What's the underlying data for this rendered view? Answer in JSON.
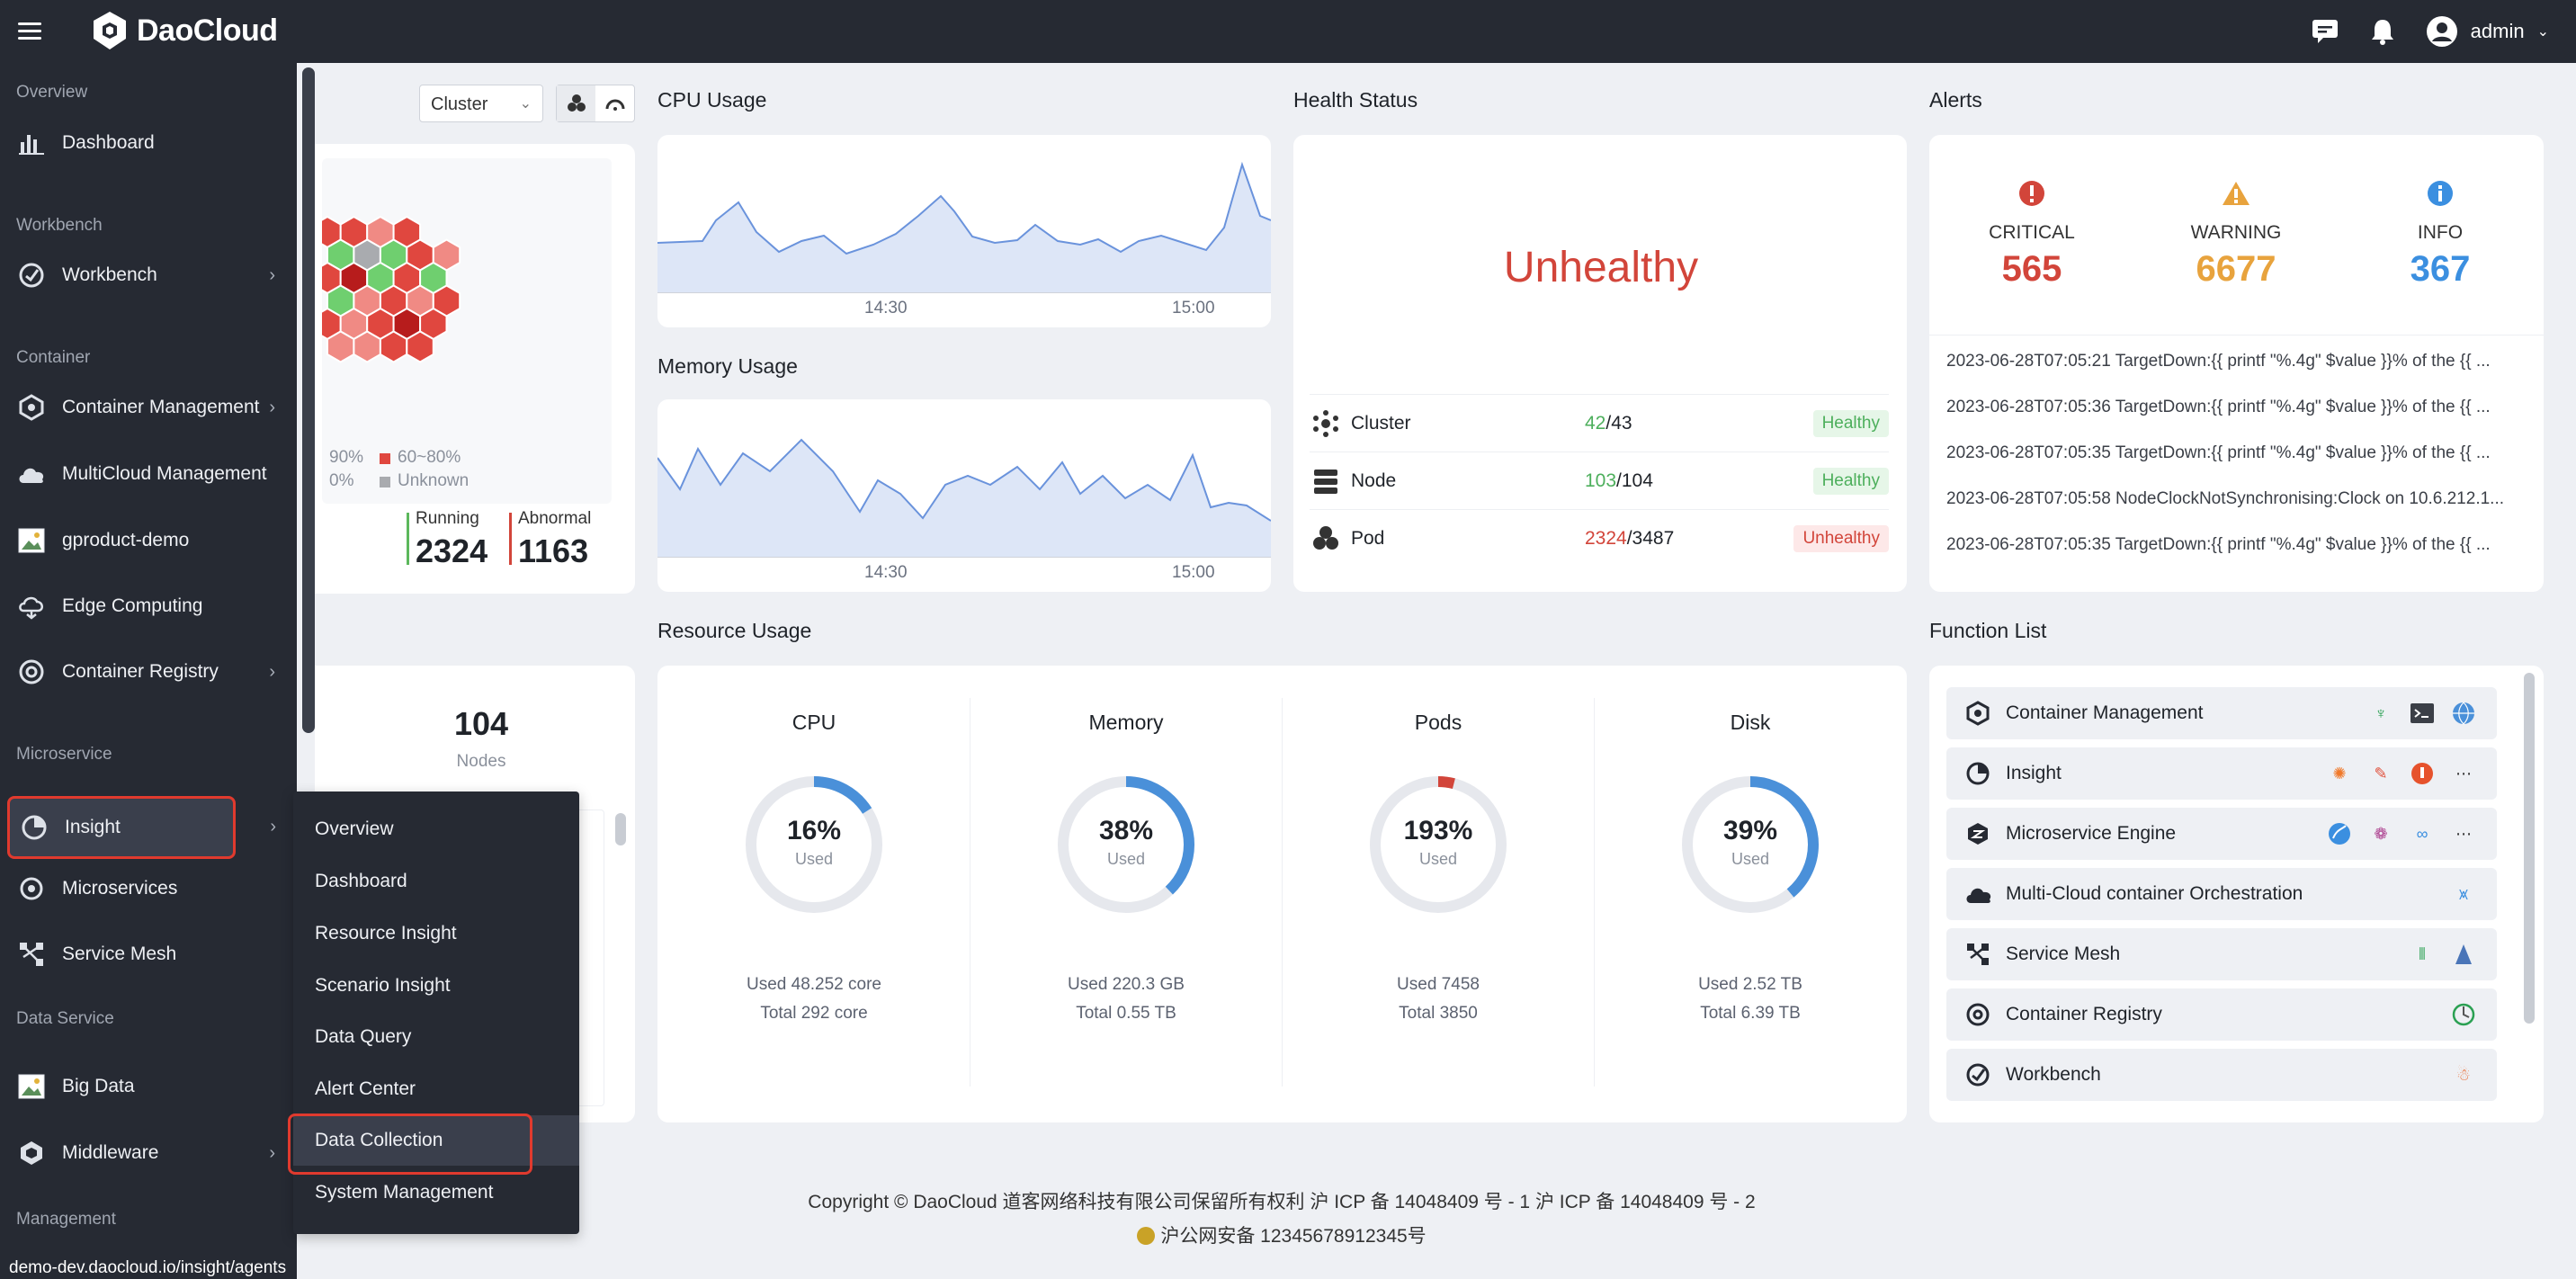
{
  "topbar": {
    "brand": "DaoCloud",
    "user": "admin"
  },
  "sidebar": {
    "groups": {
      "overview": "Overview",
      "workbench": "Workbench",
      "container": "Container",
      "microservice": "Microservice",
      "data_service": "Data Service",
      "management": "Management"
    },
    "items": {
      "dashboard": "Dashboard",
      "workbench": "Workbench",
      "container_management": "Container Management",
      "multicloud": "MultiCloud Management",
      "gproduct": "gproduct-demo",
      "edge": "Edge Computing",
      "registry": "Container Registry",
      "insight": "Insight",
      "microservices": "Microservices",
      "service_mesh": "Service Mesh",
      "big_data": "Big Data",
      "middleware": "Middleware"
    }
  },
  "submenu": {
    "items": [
      "Overview",
      "Dashboard",
      "Resource Insight",
      "Scenario Insight",
      "Data Query",
      "Alert Center",
      "Data Collection",
      "System Management"
    ]
  },
  "cluster_card": {
    "select": "Cluster",
    "legend": {
      "a": "90%",
      "b": "60~80%",
      "c": "0%",
      "d": "Unknown"
    },
    "running_label": "Running",
    "running_value": "2324",
    "abnormal_label": "Abnormal",
    "abnormal_value": "1163"
  },
  "cpu_usage": {
    "title": "CPU Usage",
    "ticks": [
      "14:30",
      "15:00"
    ]
  },
  "memory_usage": {
    "title": "Memory Usage",
    "ticks": [
      "14:30",
      "15:00"
    ]
  },
  "health": {
    "title": "Health Status",
    "status": "Unhealthy",
    "rows": [
      {
        "label": "Cluster",
        "ok": "42",
        "total": "/43",
        "badge": "Healthy"
      },
      {
        "label": "Node",
        "ok": "103",
        "total": "/104",
        "badge": "Healthy"
      },
      {
        "label": "Pod",
        "ok": "2324",
        "total": "/3487",
        "badge": "Unhealthy"
      }
    ]
  },
  "alerts": {
    "title": "Alerts",
    "critical_label": "CRITICAL",
    "critical_value": "565",
    "warning_label": "WARNING",
    "warning_value": "6677",
    "info_label": "INFO",
    "info_value": "367",
    "lines": [
      "2023-06-28T07:05:21 TargetDown:{{ printf \"%.4g\" $value }}% of the {{ ...",
      "2023-06-28T07:05:36 TargetDown:{{ printf \"%.4g\" $value }}% of the {{ ...",
      "2023-06-28T07:05:35 TargetDown:{{ printf \"%.4g\" $value }}% of the {{ ...",
      "2023-06-28T07:05:58 NodeClockNotSynchronising:Clock on 10.6.212.1...",
      "2023-06-28T07:05:35 TargetDown:{{ printf \"%.4g\" $value }}% of the {{ ..."
    ]
  },
  "resource_usage": {
    "title": "Resource Usage",
    "nodes_value": "104",
    "nodes_label": "Nodes",
    "rings": [
      {
        "title": "CPU",
        "pct": 16,
        "pct_text": "16%",
        "used_word": "Used",
        "used": "Used 48.252 core",
        "total": "Total 292 core",
        "color": "#4a90d9"
      },
      {
        "title": "Memory",
        "pct": 38,
        "pct_text": "38%",
        "used_word": "Used",
        "used": "Used 220.3 GB",
        "total": "Total 0.55 TB",
        "color": "#4a90d9"
      },
      {
        "title": "Pods",
        "pct": 193,
        "pct_text": "193%",
        "used_word": "Used",
        "used": "Used 7458",
        "total": "Total 3850",
        "color": "#d2453a"
      },
      {
        "title": "Disk",
        "pct": 39,
        "pct_text": "39%",
        "used_word": "Used",
        "used": "Used 2.52 TB",
        "total": "Total 6.39 TB",
        "color": "#4a90d9"
      }
    ]
  },
  "function_list": {
    "title": "Function List",
    "rows": [
      "Container Management",
      "Insight",
      "Microservice Engine",
      "Multi-Cloud container Orchestration",
      "Service Mesh",
      "Container Registry",
      "Workbench"
    ]
  },
  "footer": {
    "line1": "Copyright © DaoCloud 道客网络科技有限公司保留所有权利  沪 ICP 备 14048409 号 - 1  沪 ICP 备 14048409 号 - 2",
    "line2": "沪公网安备 12345678912345号"
  },
  "status_url": "demo-dev.daocloud.io/insight/agents",
  "colors": {
    "critical": "#d2453a",
    "warning": "#e8a33d",
    "info": "#3b8fe0",
    "healthy": "#4daf5c"
  }
}
